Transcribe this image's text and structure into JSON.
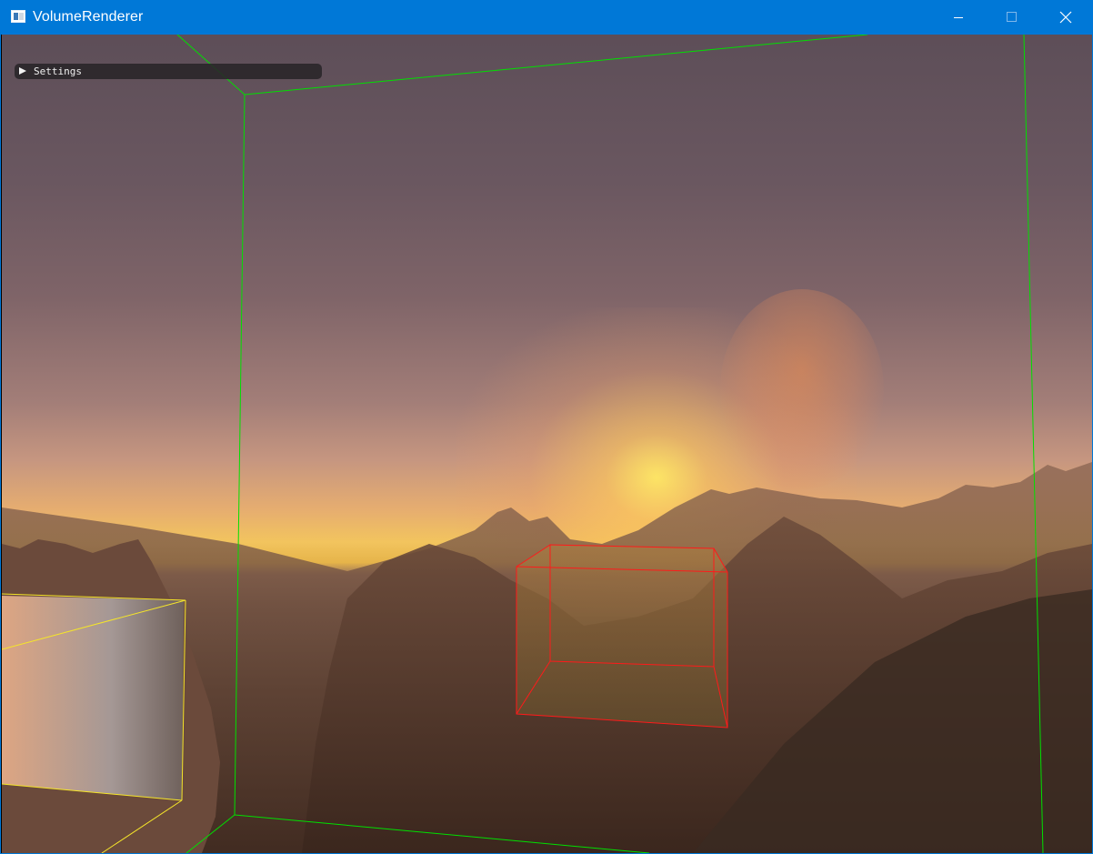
{
  "window": {
    "title": "VolumeRenderer",
    "icon": "app-window-icon",
    "controls": {
      "minimize_icon": "minimize-icon",
      "maximize_icon": "maximize-icon",
      "close_icon": "close-icon"
    },
    "accent_color": "#0078d7"
  },
  "overlay": {
    "settings_label": "Settings",
    "settings_state": "collapsed",
    "settings_icon": "triangle-right-icon"
  },
  "scene": {
    "bounding_boxes": [
      {
        "name": "green",
        "color": "#00e000"
      },
      {
        "name": "red",
        "color": "#ff1a1a"
      },
      {
        "name": "yellow",
        "color": "#f5e52a"
      }
    ]
  }
}
